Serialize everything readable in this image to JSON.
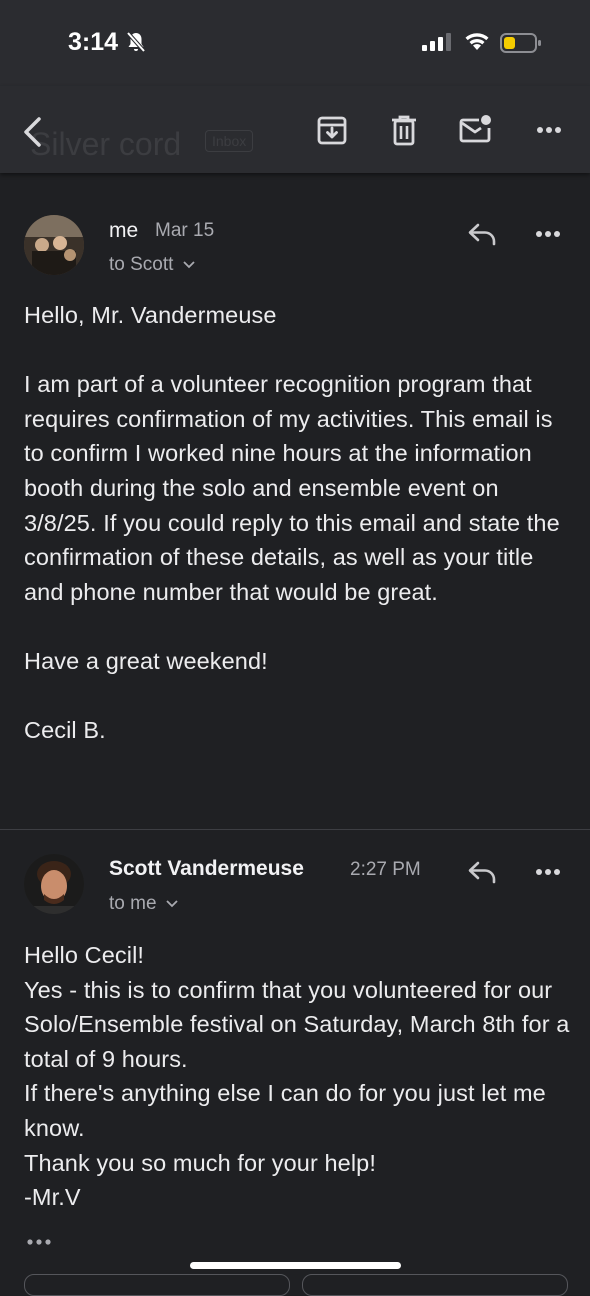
{
  "status_bar": {
    "time": "3:14"
  },
  "toolbar": {
    "ghost_title": "Silver cord",
    "ghost_badge": "Inbox"
  },
  "messages": [
    {
      "sender": "me",
      "date": "Mar 15",
      "to": "to Scott",
      "body": "Hello, Mr. Vandermeuse\n\nI am part of a volunteer recognition program that requires confirmation of my activities. This email is to confirm I worked nine hours at the information booth during the solo and ensemble event on 3/8/25. If you could reply to this email and state the confirmation of these details, as well as your title and phone number that would be great.\n\nHave a great weekend!\n\nCecil B."
    },
    {
      "sender": "Scott Vandermeuse",
      "date": "2:27 PM",
      "to": "to me",
      "body": "Hello Cecil!\nYes - this is to confirm that you volunteered for our Solo/Ensemble festival on Saturday, March 8th for a total of 9 hours.\nIf there's anything else I can do for you just let me know.\nThank you so much for your help!\n-Mr.V"
    }
  ],
  "colors": {
    "background": "#1f2023",
    "bar": "#2b2c30",
    "battery": "#f5cc00"
  }
}
